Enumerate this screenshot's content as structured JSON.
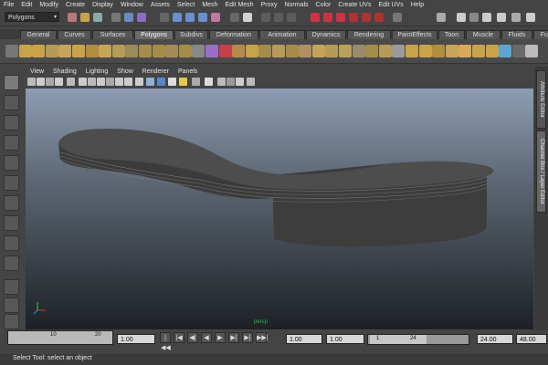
{
  "menubar": {
    "items": [
      "File",
      "Edit",
      "Modify",
      "Create",
      "Display",
      "Window",
      "Assets",
      "Select",
      "Mesh",
      "Edit Mesh",
      "Proxy",
      "Normals",
      "Color",
      "Create UVs",
      "Edit UVs",
      "Help"
    ]
  },
  "statusline": {
    "mode_selector": "Polygons",
    "mode_arrow": "▾"
  },
  "shelf": {
    "tabs": [
      "General",
      "Curves",
      "Surfaces",
      "Polygons",
      "Subdivs",
      "Deformation",
      "Animation",
      "Dynamics",
      "Rendering",
      "PaintEffects",
      "Toon",
      "Muscle",
      "Fluids",
      "Fur"
    ],
    "active_tab": "Polygons"
  },
  "panel": {
    "menus": [
      "View",
      "Shading",
      "Lighting",
      "Show",
      "Renderer",
      "Panels"
    ],
    "camera_label": "persp"
  },
  "sidebar": {
    "attribute_editor": "Attribute Editor",
    "channel_box": "Channel Box / Layer Editor"
  },
  "timeline": {
    "tick_10": "10",
    "tick_20": "20",
    "current_frame": "1.00",
    "start_time": "1.00",
    "playback_start": "1.00",
    "range_start_label": "1",
    "range_end_label": "24",
    "playback_end": "24.00",
    "end_time": "48.00",
    "buttons": [
      "|◀◀",
      "|◀",
      "◀|",
      "◀",
      "▶",
      "▶|",
      "▶|",
      "▶▶|"
    ]
  },
  "helpline": {
    "text": "Select Tool: select an object"
  },
  "colors": {
    "viewport_top": "#8e9db2",
    "viewport_bottom": "#1d2125",
    "mesh": "#4a4a4a",
    "ui_bg": "#444444"
  }
}
